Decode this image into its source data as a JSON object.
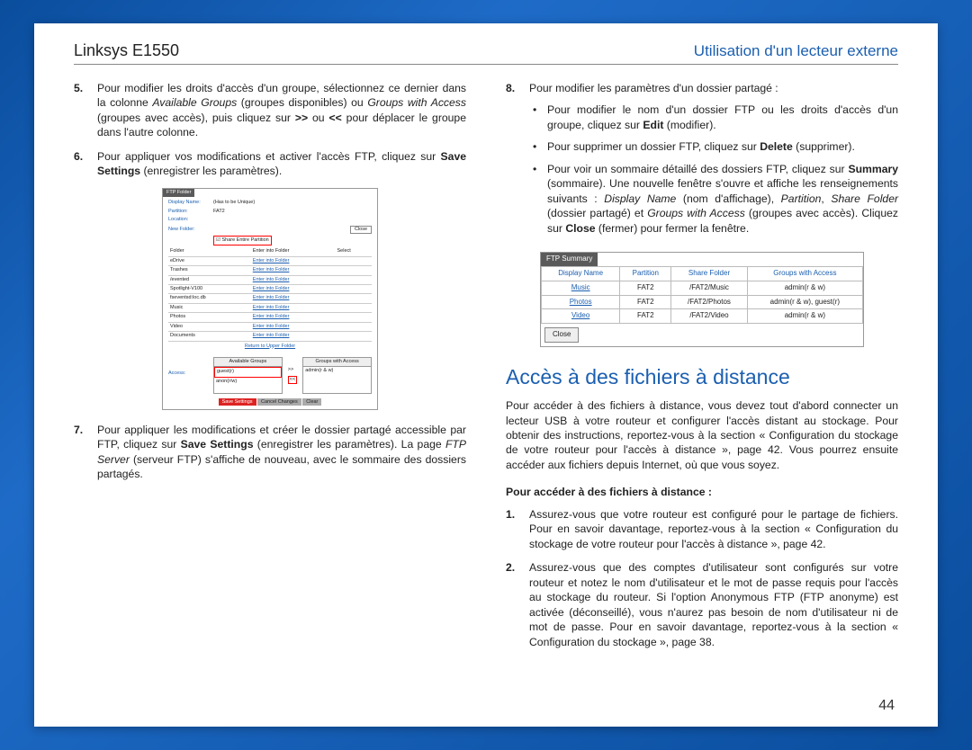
{
  "header": {
    "left": "Linksys E1550",
    "right": "Utilisation d'un lecteur externe"
  },
  "page_number": "44",
  "left_col": {
    "item5": {
      "num": "5.",
      "text": "Pour modifier les droits d'accès d'un groupe, sélectionnez ce dernier dans la colonne Available Groups (groupes disponibles) ou Groups with Access (groupes avec accès), puis cliquez sur >> ou << pour déplacer le groupe dans l'autre colonne."
    },
    "item6": {
      "num": "6.",
      "text_prefix": "Pour appliquer vos modifications et activer l'accès FTP, cliquez sur ",
      "save_bold": "Save Settings",
      "text_suffix": " (enregistrer les paramètres)."
    },
    "item7": {
      "num": "7.",
      "text_prefix": "Pour appliquer les modifications et créer le dossier partagé accessible par FTP, cliquez sur ",
      "save_bold": "Save Settings",
      "text_mid": " (enregistrer les paramètres). La page ",
      "ftp_italic": "FTP Server",
      "text_suffix": " (serveur FTP) s'affiche de nouveau, avec le sommaire des dossiers partagés."
    },
    "shot1": {
      "tab": "FTP Folder",
      "display_name": "Display Name:",
      "display_val": "(Has to be Unique)",
      "partition": "Partition:",
      "partition_val": "FAT2",
      "location": "Location:",
      "new_folder": "New Folder:",
      "close": "Close",
      "share_checkbox": "Share Entire Partition",
      "folder_hdr": "Folder",
      "enter_hdr": "Enter into Folder",
      "select_hdr": "Select",
      "folders": [
        "eDrive",
        "Trashes",
        "/evented",
        "Spotlight-V100",
        "fseventsd:loc.db",
        "Music",
        "Photos",
        "Video",
        "Documents"
      ],
      "enter_link": "Enter into Folder",
      "return_link": "Return to Upper Folder",
      "access_lbl": "Access:",
      "avail_groups": "Available Groups",
      "groups_access": "Groups with Access",
      "avail_items": [
        "guest(r)",
        "anon(r/w)"
      ],
      "access_items": [
        "admin(r & w)"
      ],
      "save_btn": "Save Settings",
      "cancel_btn": "Cancel Changes",
      "clear_btn": "Clear"
    }
  },
  "right_col": {
    "item8": {
      "num": "8.",
      "text": "Pour modifier les paramètres d'un dossier partagé :"
    },
    "bullet1_prefix": "Pour modifier le nom d'un dossier FTP ou les droits d'accès d'un groupe, cliquez sur ",
    "bullet1_bold": "Edit",
    "bullet1_suffix": " (modifier).",
    "bullet2_prefix": "Pour supprimer un dossier FTP, cliquez sur ",
    "bullet2_bold": "Delete",
    "bullet2_suffix": " (supprimer).",
    "bullet3_prefix": "Pour voir un sommaire détaillé des dossiers FTP, cliquez sur ",
    "bullet3_bold": "Summary",
    "bullet3_mid": " (sommaire). Une nouvelle fenêtre s'ouvre et affiche les renseignements suivants : ",
    "bullet3_i1": "Display Name",
    "bullet3_t1": " (nom d'affichage), ",
    "bullet3_i2": "Partition",
    "bullet3_t2": ", ",
    "bullet3_i3": "Share Folder",
    "bullet3_t3": " (dossier partagé) et ",
    "bullet3_i4": "Groups with Access",
    "bullet3_t4": " (groupes avec accès). Cliquez sur ",
    "bullet3_bold2": "Close",
    "bullet3_suffix": " (fermer) pour fermer la fenêtre.",
    "shot2": {
      "tab": "FTP Summary",
      "headers": [
        "Display Name",
        "Partition",
        "Share Folder",
        "Groups with Access"
      ],
      "rows": [
        [
          "Music",
          "FAT2",
          "/FAT2/Music",
          "admin(r & w)"
        ],
        [
          "Photos",
          "FAT2",
          "/FAT2/Photos",
          "admin(r & w), guest(r)"
        ],
        [
          "Video",
          "FAT2",
          "/FAT2/Video",
          "admin(r & w)"
        ]
      ],
      "close": "Close"
    },
    "section_title": "Accès à des fichiers à distance",
    "section_para": "Pour accéder à des fichiers à distance, vous devez tout d'abord connecter un lecteur USB à votre routeur et configurer l'accès distant au stockage. Pour obtenir des instructions, reportez-vous à la section « Configuration du stockage de votre routeur pour l'accès à distance », page 42. Vous pourrez ensuite accéder aux fichiers depuis Internet, où que vous soyez.",
    "subtitle": "Pour accéder à des fichiers à distance :",
    "step1": {
      "num": "1.",
      "text": "Assurez-vous que votre routeur est configuré pour le partage de fichiers. Pour en savoir davantage, reportez-vous à la section « Configuration du stockage de votre routeur pour l'accès à distance », page 42."
    },
    "step2": {
      "num": "2.",
      "text": "Assurez-vous que des comptes d'utilisateur sont configurés sur votre routeur et notez le nom d'utilisateur et le mot de passe requis pour l'accès au stockage du routeur. Si l'option Anonymous FTP (FTP anonyme) est activée (déconseillé), vous n'aurez pas besoin de nom d'utilisateur ni de mot de passe. Pour en savoir davantage, reportez-vous à la section « Configuration du stockage », page 38."
    }
  }
}
